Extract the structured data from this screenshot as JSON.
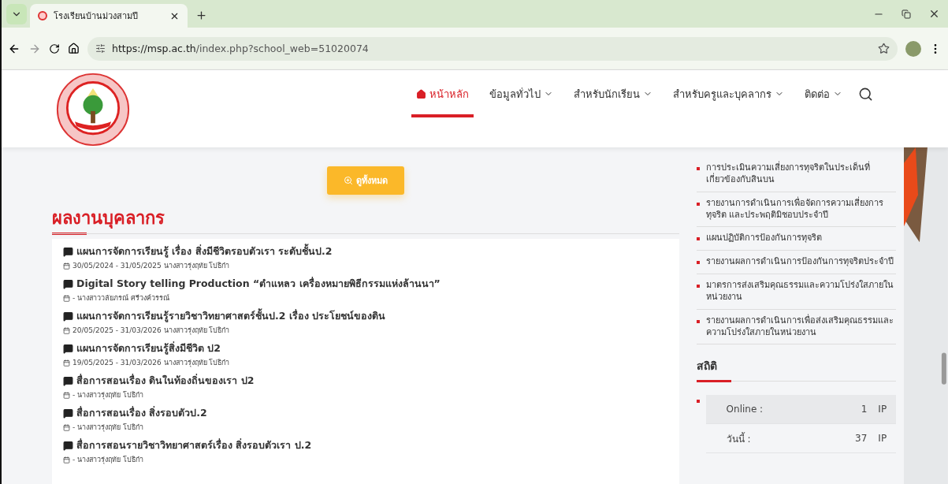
{
  "browser": {
    "tabs": [
      {
        "title": "โรงเรียนบ้านม่วงสามปี",
        "selected": true
      }
    ],
    "url_host": "https://msp.ac.th",
    "url_path": "/index.php?school_web=51020074"
  },
  "header": {
    "nav": [
      {
        "label": "หน้าหลัก",
        "selected": true,
        "has_menu": false,
        "home": true
      },
      {
        "label": "ข้อมูลทั่วไป",
        "selected": false,
        "has_menu": true,
        "home": false
      },
      {
        "label": "สำหรับนักเรียน",
        "selected": false,
        "has_menu": true,
        "home": false
      },
      {
        "label": "สำหรับครูและบุคลากร",
        "selected": false,
        "has_menu": true,
        "home": false
      },
      {
        "label": "ติดต่อ",
        "selected": false,
        "has_menu": true,
        "home": false
      }
    ]
  },
  "view_all_button": "ดูทั้งหมด",
  "section_title": "ผลงานบุคลากร",
  "works": [
    {
      "title": "แผนการจัดการเรียนรู้ เรื่อง สิ่งมีชีวิตรอบตัวเรา ระดับชั้นป.2",
      "meta": "30/05/2024 - 31/05/2025 นางสาวรุ่งฤทัย โปธิก๋า"
    },
    {
      "title": "Digital Story telling Production “ตำแหลว เครื่องหมายพิธีกรรมแห่งล้านนา”",
      "meta": "- นางสาววลัยภรณ์ ศรีวงค์วรรณ์"
    },
    {
      "title": "แผนการจัดการเรียนรู้รายวิชาวิทยาศาสตร์ชั้นป.2 เรื่อง ประโยชน์ของดิน",
      "meta": "20/05/2025 - 31/03/2026 นางสาวรุ่งฤทัย โปธิก๋า"
    },
    {
      "title": "แผนการจัดการเรียนรู้สิ่งมีชีวิต ป2",
      "meta": "19/05/2025 - 31/03/2026 นางสาวรุ่งฤทัย โปธิก๋า"
    },
    {
      "title": "สื่อการสอนเรื่อง ดินในท้องถิ่นของเรา ป2",
      "meta": "- นางสาวรุ่งฤทัย โปธิก๋า"
    },
    {
      "title": "สื่อการสอนเรื่อง สิ่งรอบตัวป.2",
      "meta": "- นางสาวรุ่งฤทัย โปธิก๋า"
    },
    {
      "title": "สื่อการสอนรายวิชาวิทยาศาสตร์เรื่อง สิ่งรอบตัวเรา ป.2",
      "meta": "- นางสาวรุ่งฤทัย โปธิก๋า"
    }
  ],
  "sidebar_links": [
    "การประเมินความเสี่ยงการทุจริตในประเด็นที่เกี่ยวข้องกับสินบน",
    "รายงานการดำเนินการเพื่อจัดการความเสี่ยงการทุจริต และประพฤติมิชอบประจำปี",
    "แผนปฏิบัติการป้องกันการทุจริต",
    "รายงานผลการดำเนินการป้องกันการทุจริตประจำปี",
    "มาตรการส่งเสริมคุณธรรมและความโปร่งใสภายในหน่วยงาน",
    "รายงานผลการดำเนินการเพื่อส่งเสริมคุณธรรมและความโปร่งใสภายในหน่วยงาน"
  ],
  "stats": {
    "title": "สถิติ",
    "rows": [
      {
        "label": "Online :",
        "count": "1",
        "unit": "IP"
      },
      {
        "label": "วันนี้ :",
        "count": "37",
        "unit": "IP"
      }
    ]
  }
}
